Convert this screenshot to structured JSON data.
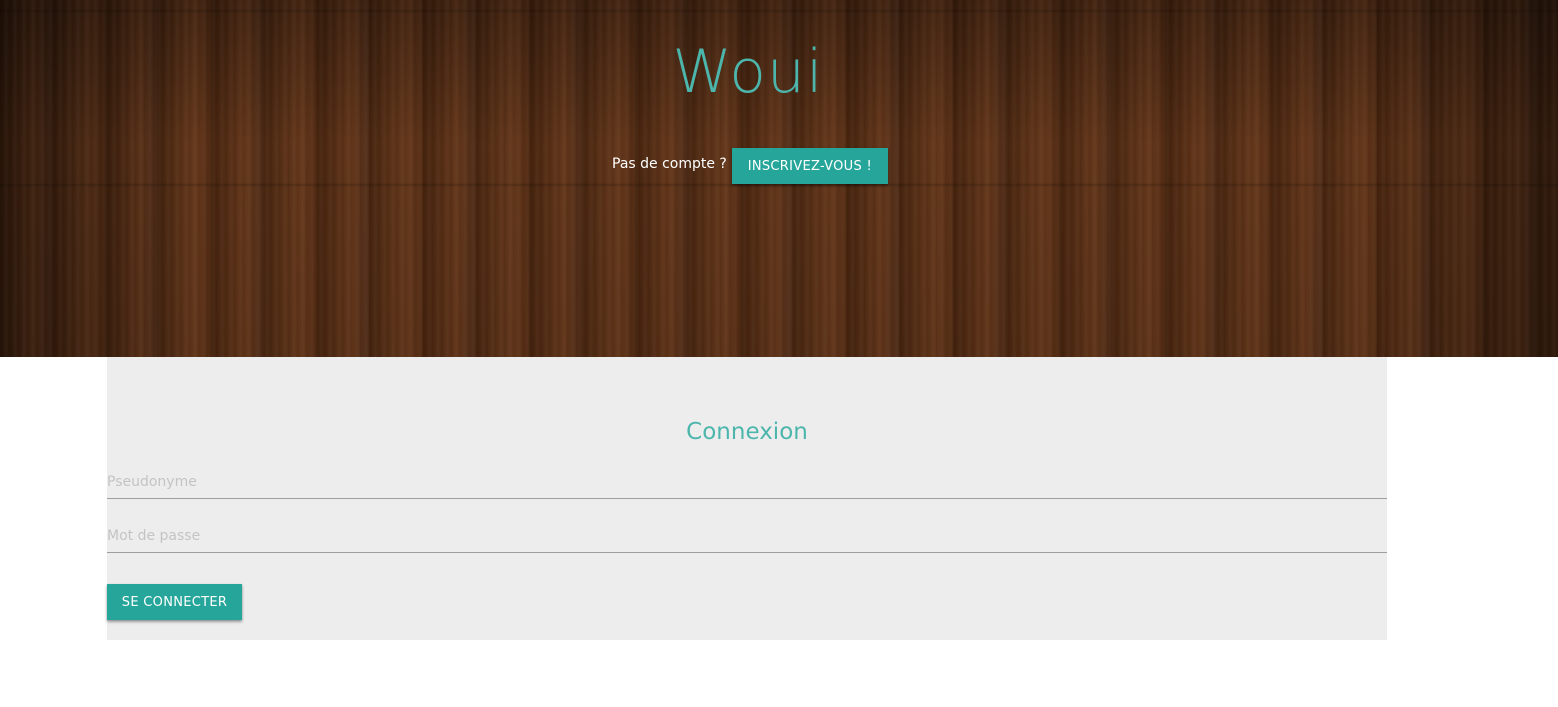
{
  "header": {
    "title": "Woui",
    "signup_prompt": "Pas de compte ?",
    "signup_button": "INSCRIVEZ-VOUS !"
  },
  "login": {
    "title": "Connexion",
    "username_placeholder": "Pseudonyme",
    "password_placeholder": "Mot de passe",
    "submit_button": "SE CONNECTER"
  },
  "colors": {
    "accent": "#26a69a",
    "accent_text": "#4db6ac",
    "panel_bg": "#ededed"
  }
}
